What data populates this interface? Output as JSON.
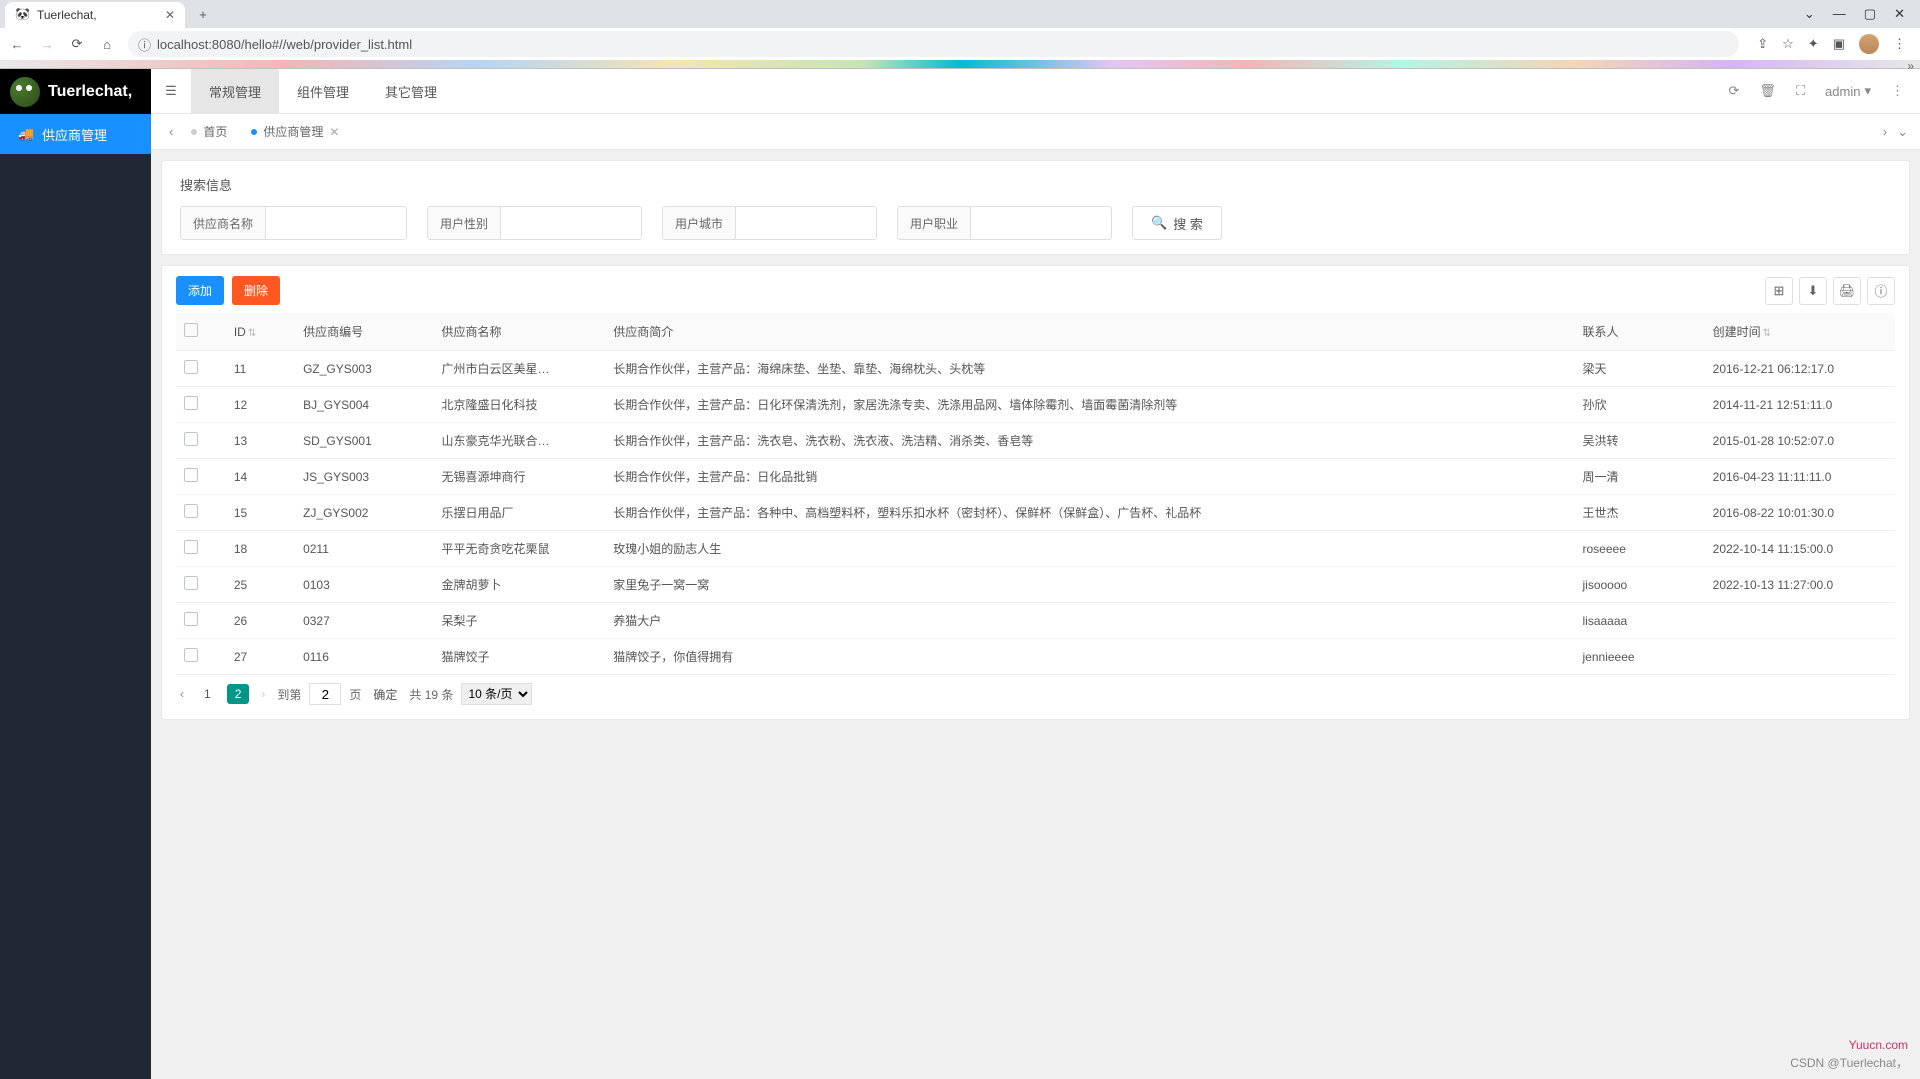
{
  "browser": {
    "tab_title": "Tuerlechat,",
    "url": "localhost:8080/hello#//web/provider_list.html"
  },
  "app": {
    "logo_text": "Tuerlechat,",
    "sidebar": {
      "item_label": "供应商管理"
    },
    "topmenu": {
      "item1": "常规管理",
      "item2": "组件管理",
      "item3": "其它管理"
    },
    "user": "admin",
    "tabs": {
      "home": "首页",
      "current": "供应商管理"
    }
  },
  "search": {
    "title": "搜索信息",
    "fields": {
      "name": "供应商名称",
      "gender": "用户性别",
      "city": "用户城市",
      "job": "用户职业"
    },
    "button": "搜 索"
  },
  "actions": {
    "add": "添加",
    "delete": "删除"
  },
  "table": {
    "headers": {
      "id": "ID",
      "number": "供应商编号",
      "name": "供应商名称",
      "desc": "供应商简介",
      "contact": "联系人",
      "time": "创建时间"
    },
    "rows": [
      {
        "id": "11",
        "num": "GZ_GYS003",
        "name": "广州市白云区美星…",
        "desc": "长期合作伙伴，主营产品：海绵床垫、坐垫、靠垫、海绵枕头、头枕等",
        "contact": "梁天",
        "time": "2016-12-21 06:12:17.0"
      },
      {
        "id": "12",
        "num": "BJ_GYS004",
        "name": "北京隆盛日化科技",
        "desc": "长期合作伙伴，主营产品：日化环保清洗剂，家居洗涤专卖、洗涤用品网、墙体除霉剂、墙面霉菌清除剂等",
        "contact": "孙欣",
        "time": "2014-11-21 12:51:11.0"
      },
      {
        "id": "13",
        "num": "SD_GYS001",
        "name": "山东豪克华光联合…",
        "desc": "长期合作伙伴，主营产品：洗衣皂、洗衣粉、洗衣液、洗洁精、消杀类、香皂等",
        "contact": "吴洪转",
        "time": "2015-01-28 10:52:07.0"
      },
      {
        "id": "14",
        "num": "JS_GYS003",
        "name": "无锡喜源坤商行",
        "desc": "长期合作伙伴，主营产品：日化品批销",
        "contact": "周一清",
        "time": "2016-04-23 11:11:11.0"
      },
      {
        "id": "15",
        "num": "ZJ_GYS002",
        "name": "乐摆日用品厂",
        "desc": "长期合作伙伴，主营产品：各种中、高档塑料杯，塑料乐扣水杯（密封杯）、保鲜杯（保鲜盒）、广告杯、礼品杯",
        "contact": "王世杰",
        "time": "2016-08-22 10:01:30.0"
      },
      {
        "id": "18",
        "num": "0211",
        "name": "平平无奇贪吃花栗鼠",
        "desc": "玫瑰小姐的励志人生",
        "contact": "roseeee",
        "time": "2022-10-14 11:15:00.0"
      },
      {
        "id": "25",
        "num": "0103",
        "name": "金牌胡萝卜",
        "desc": "家里兔子一窝一窝",
        "contact": "jisooooo",
        "time": "2022-10-13 11:27:00.0"
      },
      {
        "id": "26",
        "num": "0327",
        "name": "呆梨子",
        "desc": "养猫大户",
        "contact": "lisaaaaa",
        "time": ""
      },
      {
        "id": "27",
        "num": "0116",
        "name": "猫牌饺子",
        "desc": "猫牌饺子，你值得拥有",
        "contact": "jennieeee",
        "time": ""
      }
    ]
  },
  "pagination": {
    "page1": "1",
    "page2": "2",
    "goto_label": "到第",
    "page_unit": "页",
    "confirm": "确定",
    "total": "共 19 条",
    "per_page": "10 条/页",
    "current_input": "2"
  },
  "watermark": {
    "line1": "Yuucn.com",
    "line2": "CSDN @Tuerlechat，"
  }
}
